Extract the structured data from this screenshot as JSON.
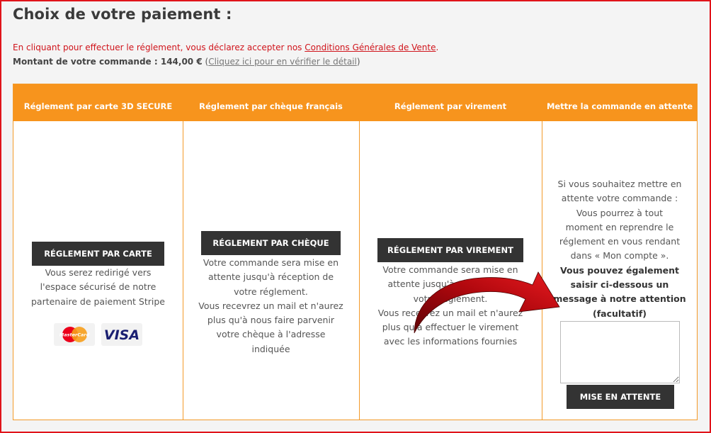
{
  "page": {
    "title": "Choix de votre paiement :",
    "notice_text": "En cliquant pour effectuer le réglement, vous déclarez accepter nos ",
    "notice_link": "Conditions Générales de Vente",
    "notice_end": ".",
    "amount_label": "Montant de votre commande : 144,00 €",
    "amount_link": "Cliquez ici pour en vérifier le détail"
  },
  "columns": [
    {
      "header": "Réglement par carte 3D SECURE",
      "button": "RÉGLEMENT PAR CARTE",
      "lines": [
        "Vous serez redirigé vers",
        "l'espace sécurisé de notre",
        "partenaire de paiement Stripe"
      ],
      "logos": [
        "MasterCard",
        "VISA"
      ]
    },
    {
      "header": "Réglement par chèque français",
      "button": "RÉGLEMENT PAR CHÈQUE",
      "lines": [
        "Votre commande sera mise en",
        "attente jusqu'à réception de",
        "votre réglement.",
        "Vous recevrez un mail et n'aurez",
        "plus qu'à nous faire parvenir",
        "votre chèque à l'adresse",
        "indiquée"
      ]
    },
    {
      "header": "Réglement par virement",
      "button": "RÉGLEMENT PAR VIREMENT",
      "lines": [
        "Votre commande sera mise en",
        "attente jusqu'à réception de",
        "votre réglement.",
        "Vous recevrez un mail et n'aurez",
        "plus qu'à effectuer le virement",
        "avec les informations fournies"
      ]
    },
    {
      "header": "Mettre la commande en attente",
      "button": "MISE EN ATTENTE",
      "lines": [
        "Si vous souhaitez mettre en",
        "attente votre commande :",
        "Vous pourrez à tout",
        "moment en reprendre le",
        "réglement en vous rendant",
        "dans « Mon compte »."
      ],
      "bold_lines": [
        "Vous pouvez également",
        "saisir ci-dessous un",
        "message à notre attention",
        "(facultatif)"
      ],
      "textarea_value": ""
    }
  ],
  "colors": {
    "accent": "#f7941d",
    "button": "#333333",
    "notice": "#d0141b",
    "arrow": "#c10d12"
  }
}
